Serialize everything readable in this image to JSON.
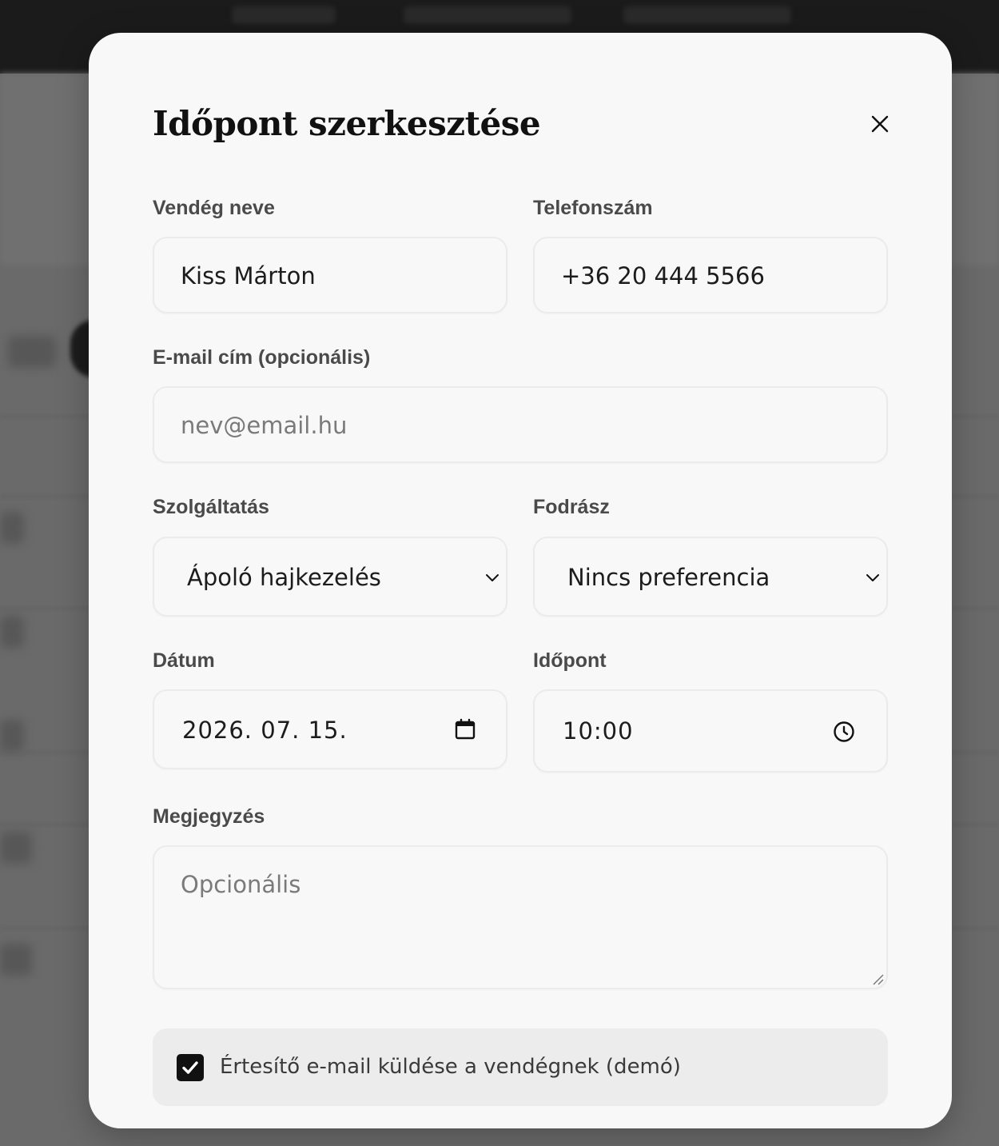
{
  "modal": {
    "title": "Időpont szerkesztése",
    "close_icon": "close-icon"
  },
  "form": {
    "guest_name": {
      "label": "Vendég neve",
      "value": "Kiss Márton"
    },
    "phone": {
      "label": "Telefonszám",
      "value": "+36 20 444 5566"
    },
    "email": {
      "label": "E-mail cím (opcionális)",
      "value": "",
      "placeholder": "nev@email.hu"
    },
    "service": {
      "label": "Szolgáltatás",
      "selected": "Ápoló hajkezelés",
      "icon": "chevron-down-icon"
    },
    "stylist": {
      "label": "Fodrász",
      "selected": "Nincs preferencia",
      "icon": "chevron-down-icon"
    },
    "date": {
      "label": "Dátum",
      "value": "2026. 07. 15.",
      "icon": "calendar-icon"
    },
    "time": {
      "label": "Időpont",
      "value": "10:00",
      "icon": "clock-icon"
    },
    "note": {
      "label": "Megjegyzés",
      "value": "",
      "placeholder": "Opcionális"
    },
    "notify": {
      "label": "Értesítő e-mail küldése a vendégnek (demó)",
      "checked": true
    }
  },
  "colors": {
    "modal_background": "#f8f8f8",
    "field_border": "#ebebeb",
    "checkbox_fill": "#111111",
    "overlay": "#5e5e5e"
  }
}
